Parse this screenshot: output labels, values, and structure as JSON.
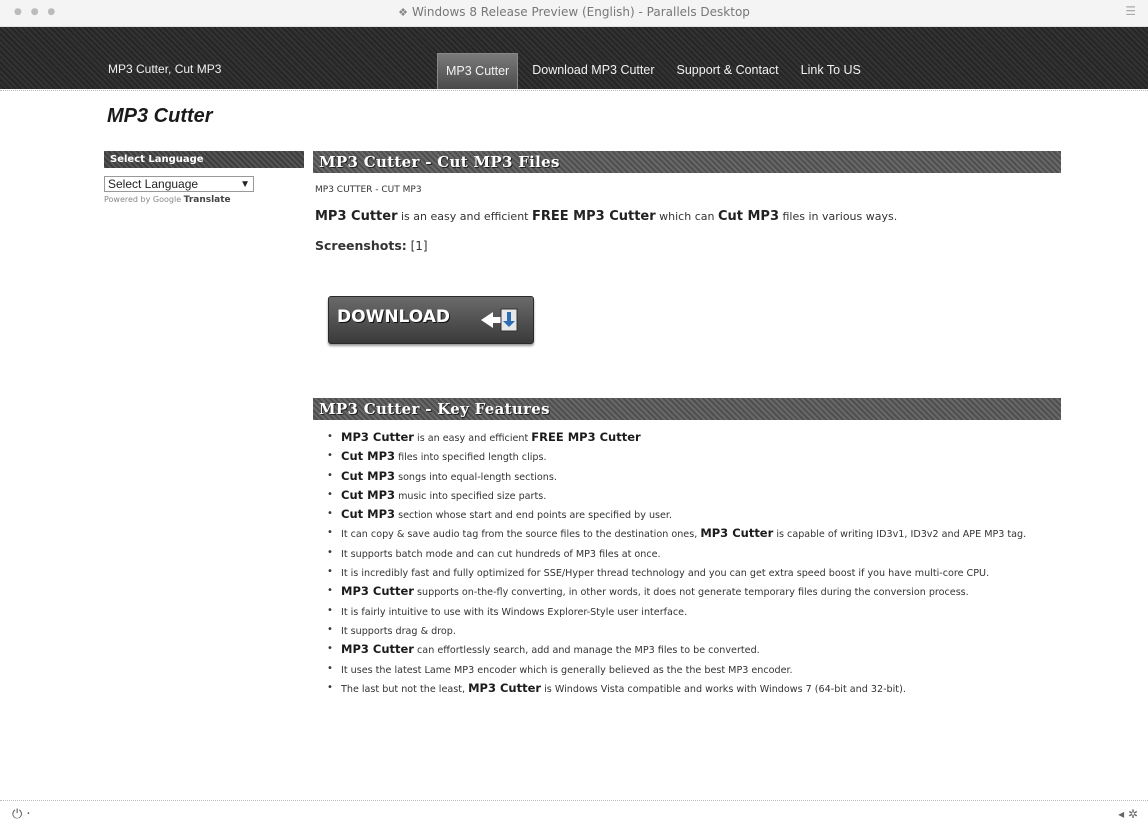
{
  "window": {
    "title": "Windows 8 Release Preview (English) - Parallels Desktop"
  },
  "header": {
    "site_name": "MP3 Cutter, Cut MP3",
    "nav": [
      {
        "label": "MP3 Cutter",
        "active": true
      },
      {
        "label": "Download MP3 Cutter",
        "active": false
      },
      {
        "label": "Support & Contact",
        "active": false
      },
      {
        "label": "Link To US",
        "active": false
      }
    ]
  },
  "page_title": "MP3 Cutter",
  "sidebar": {
    "heading": "Select Language",
    "select_value": "Select Language",
    "powered_by": "Powered by Google",
    "translate": "Translate"
  },
  "main": {
    "section_title": "MP3 Cutter - Cut MP3 Files",
    "subline": "MP3 CUTTER - CUT MP3",
    "intro": {
      "b1": "MP3 Cutter",
      "t1": " is an easy and efficient ",
      "b2": "FREE MP3 Cutter",
      "t2": " which can ",
      "b3": "Cut MP3",
      "t3": " files in various ways."
    },
    "screenshots_label": "Screenshots:",
    "screenshots_link": " [1]",
    "download_label": "DOWNLOAD",
    "features_title": "MP3 Cutter - Key Features",
    "features": [
      {
        "b": "MP3 Cutter",
        "t": " is an easy and efficient ",
        "b2": "FREE MP3 Cutter",
        "t2": ""
      },
      {
        "b": "Cut MP3",
        "t": " files into specified length clips.",
        "b2": "",
        "t2": ""
      },
      {
        "b": "Cut MP3",
        "t": " songs into equal-length sections.",
        "b2": "",
        "t2": ""
      },
      {
        "b": "Cut MP3",
        "t": " music into specified size parts.",
        "b2": "",
        "t2": ""
      },
      {
        "b": "Cut MP3",
        "t": " section whose start and end points are specified by user.",
        "b2": "",
        "t2": ""
      },
      {
        "b": "",
        "t": "It can copy & save audio tag from the source files to the destination ones, ",
        "b2": "MP3 Cutter",
        "t2": " is capable of writing ID3v1, ID3v2 and APE MP3 tag."
      },
      {
        "b": "",
        "t": "It supports batch mode and can cut hundreds of MP3 files at once.",
        "b2": "",
        "t2": ""
      },
      {
        "b": "",
        "t": "It is incredibly fast and fully optimized for SSE/Hyper thread technology and you can get extra speed boost if you have multi-core CPU.",
        "b2": "",
        "t2": ""
      },
      {
        "b": "MP3 Cutter",
        "t": " supports on-the-fly converting, in other words, it does not generate temporary files during the conversion process.",
        "b2": "",
        "t2": ""
      },
      {
        "b": "",
        "t": "It is fairly intuitive to use with its Windows Explorer-Style user interface.",
        "b2": "",
        "t2": ""
      },
      {
        "b": "",
        "t": "It supports drag & drop.",
        "b2": "",
        "t2": ""
      },
      {
        "b": "MP3 Cutter",
        "t": " can effortlessly search, add and manage the MP3 files to be converted.",
        "b2": "",
        "t2": ""
      },
      {
        "b": "",
        "t": "It uses the latest Lame MP3 encoder which is generally believed as the the best MP3 encoder.",
        "b2": "",
        "t2": ""
      },
      {
        "b": "",
        "t": "The last but not the least, ",
        "b2": "MP3 Cutter",
        "t2": " is Windows Vista compatible and works with Windows 7 (64-bit and 32-bit)."
      }
    ]
  },
  "icons": {
    "window_icon": "windows-logo-icon",
    "download_icon": "download-arrow-icon",
    "power_icon": "power-icon"
  }
}
